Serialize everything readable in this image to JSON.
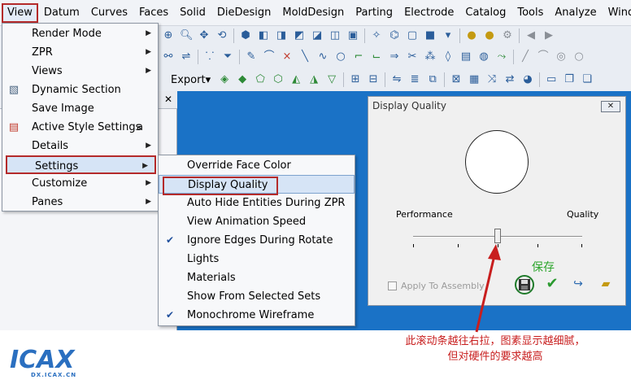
{
  "menubar": {
    "items": [
      "View",
      "Datum",
      "Curves",
      "Faces",
      "Solid",
      "DieDesign",
      "MoldDesign",
      "Parting",
      "Electrode",
      "Catalog",
      "Tools",
      "Analyze",
      "Window"
    ]
  },
  "toolbar": {
    "export_label": "Export"
  },
  "view_menu": {
    "items": [
      {
        "label": "Render Mode",
        "submenu": true
      },
      {
        "label": "ZPR",
        "submenu": true
      },
      {
        "label": "Views",
        "submenu": true
      },
      {
        "label": "Dynamic Section",
        "submenu": false,
        "icon": "dynamic-section-icon"
      },
      {
        "label": "Save Image",
        "submenu": false
      },
      {
        "label": "Active Style Settings",
        "submenu": false,
        "icon": "style-settings-icon",
        "accelerator": "a"
      },
      {
        "label": "Details",
        "submenu": true
      },
      {
        "label": "Settings",
        "submenu": true,
        "highlighted": true
      },
      {
        "label": "Customize",
        "submenu": true
      },
      {
        "label": "Panes",
        "submenu": true
      }
    ]
  },
  "settings_menu": {
    "items": [
      {
        "label": "Override Face Color",
        "checked": false
      },
      {
        "label": "Display Quality",
        "checked": false,
        "highlighted": true
      },
      {
        "label": "Auto Hide Entities During ZPR",
        "checked": false
      },
      {
        "label": "View Animation Speed",
        "checked": false
      },
      {
        "label": "Ignore Edges During Rotate",
        "checked": true
      },
      {
        "label": "Lights",
        "checked": false
      },
      {
        "label": "Materials",
        "checked": false
      },
      {
        "label": "Show From Selected Sets",
        "checked": false
      },
      {
        "label": "Monochrome Wireframe",
        "checked": true
      }
    ]
  },
  "dialog": {
    "title": "Display Quality",
    "label_left": "Performance",
    "label_right": "Quality",
    "slider_value": 0.5,
    "apply_to_assembly": "Apply To Assembly"
  },
  "annotations": {
    "save_note": "保存",
    "note_line1": "此滚动条越往右拉，图素显示越细腻，",
    "note_line2": "但对硬件的要求越高"
  },
  "logo": {
    "text": "ICAX",
    "subtext": "DX.ICAX.CN"
  },
  "colors": {
    "highlight_border": "#b42a2a",
    "workspace": "#1a72c6",
    "note": "#c81e1e",
    "save_note": "#2ba52b"
  }
}
